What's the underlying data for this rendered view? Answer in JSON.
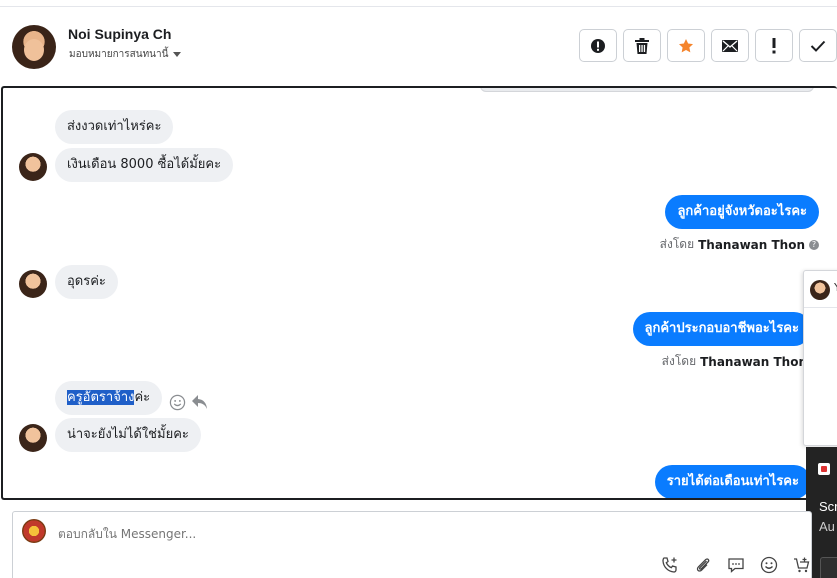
{
  "header": {
    "contact_name": "Noi Supinya Ch",
    "assign_label": "มอบหมายการสนทนานี้"
  },
  "actions": [
    {
      "name": "spam-button",
      "icon": "exclamation-circle-icon"
    },
    {
      "name": "delete-button",
      "icon": "trash-icon"
    },
    {
      "name": "star-button",
      "icon": "star-icon",
      "color": "#f5842c"
    },
    {
      "name": "mark-unread-button",
      "icon": "envelope-icon"
    },
    {
      "name": "flag-button",
      "icon": "exclamation-icon"
    },
    {
      "name": "done-button",
      "icon": "check-icon"
    }
  ],
  "messages": {
    "m1": "ส่งงวดเท่าไหร่คะ",
    "m2": "เงินเดือน 8000 ซื้อได้มั้ยคะ",
    "m3": "ลูกค้าอยู่จังหวัดอะไรคะ",
    "m3_sent_prefix": "ส่งโดย",
    "m3_sender": "Thanawan Thon",
    "m4": "อุดรค่ะ",
    "m5": "ลูกค้าประกอบอาชีพอะไรคะ",
    "m5_sent_prefix": "ส่งโดย",
    "m5_sender": "Thanawan Thon",
    "m6_highlight": "ครูอัตราจ้าง",
    "m6_rest": "ค่ะ",
    "m7": "น่าจะยังไม่ได้ใช่มั้ยคะ",
    "m8": "รายได้ต่อเดือนเท่าไรคะ"
  },
  "side_panel": {
    "name_initial": "Y",
    "title_fragment": "Scr",
    "subtitle_fragment": "Au"
  },
  "composer": {
    "placeholder": "ตอบกลับใน Messenger..."
  },
  "colors": {
    "accent": "#0a7cff",
    "incoming_bubble": "#eef0f3",
    "star": "#f5842c"
  }
}
